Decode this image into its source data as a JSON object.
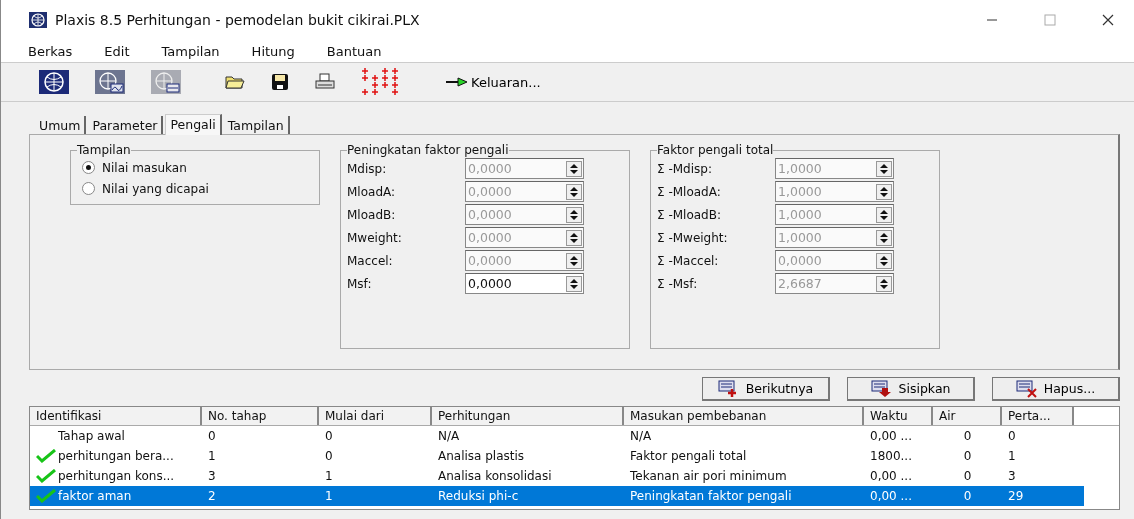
{
  "window": {
    "title": "Plaxis 8.5 Perhitungan - pemodelan bukit cikirai.PLX"
  },
  "menu": [
    "Berkas",
    "Edit",
    "Tampilan",
    "Hitung",
    "Bantuan"
  ],
  "toolbar": {
    "output_button": "Keluaran..."
  },
  "tabs": [
    {
      "label": "Umum",
      "selected": false
    },
    {
      "label": "Parameter",
      "selected": false
    },
    {
      "label": "Pengali",
      "selected": true
    },
    {
      "label": "Tampilan",
      "selected": false
    }
  ],
  "display_group": {
    "title": "Tampilan",
    "options": [
      {
        "label": "Nilai masukan",
        "selected": true
      },
      {
        "label": "Nilai yang dicapai",
        "selected": false
      }
    ]
  },
  "increment_group": {
    "title": "Peningkatan faktor pengali",
    "fields": [
      {
        "label": "Mdisp:",
        "value": "0,0000",
        "disabled": true
      },
      {
        "label": "MloadA:",
        "value": "0,0000",
        "disabled": true
      },
      {
        "label": "MloadB:",
        "value": "0,0000",
        "disabled": true
      },
      {
        "label": "Mweight:",
        "value": "0,0000",
        "disabled": true
      },
      {
        "label": "Maccel:",
        "value": "0,0000",
        "disabled": true
      },
      {
        "label": "Msf:",
        "value": "0,0000",
        "disabled": false
      }
    ]
  },
  "total_group": {
    "title": "Faktor pengali total",
    "fields": [
      {
        "label": "Σ -Mdisp:",
        "value": "1,0000",
        "disabled": true
      },
      {
        "label": "Σ -MloadA:",
        "value": "1,0000",
        "disabled": true
      },
      {
        "label": "Σ -MloadB:",
        "value": "1,0000",
        "disabled": true
      },
      {
        "label": "Σ -Mweight:",
        "value": "1,0000",
        "disabled": true
      },
      {
        "label": "Σ -Maccel:",
        "value": "0,0000",
        "disabled": true
      },
      {
        "label": "Σ -Msf:",
        "value": "2,6687",
        "disabled": true
      }
    ]
  },
  "buttons": [
    "Berikutnya",
    "Sisipkan",
    "Hapus..."
  ],
  "table": {
    "columns": [
      "Identifikasi",
      "No. tahap",
      "Mulai dari",
      "Perhitungan",
      "Masukan pembebanan",
      "Waktu",
      "Air",
      "Perta..."
    ],
    "rows": [
      {
        "checked": false,
        "selected": false,
        "cells": [
          "Tahap awal",
          "0",
          "0",
          "N/A",
          "N/A",
          "0,00 ...",
          "0",
          "0"
        ]
      },
      {
        "checked": true,
        "selected": false,
        "cells": [
          "perhitungan bera...",
          "1",
          "0",
          "Analisa plastis",
          "Faktor pengali total",
          "1800...",
          "0",
          "1"
        ]
      },
      {
        "checked": true,
        "selected": false,
        "cells": [
          "perhitungan kons...",
          "3",
          "1",
          "Analisa konsolidasi",
          "Tekanan air pori minimum",
          "0,00 ...",
          "0",
          "3"
        ]
      },
      {
        "checked": true,
        "selected": true,
        "cells": [
          "faktor aman",
          "2",
          "1",
          "Reduksi phi-c",
          "Peningkatan faktor pengali",
          "0,00 ...",
          "0",
          "29"
        ]
      }
    ]
  }
}
